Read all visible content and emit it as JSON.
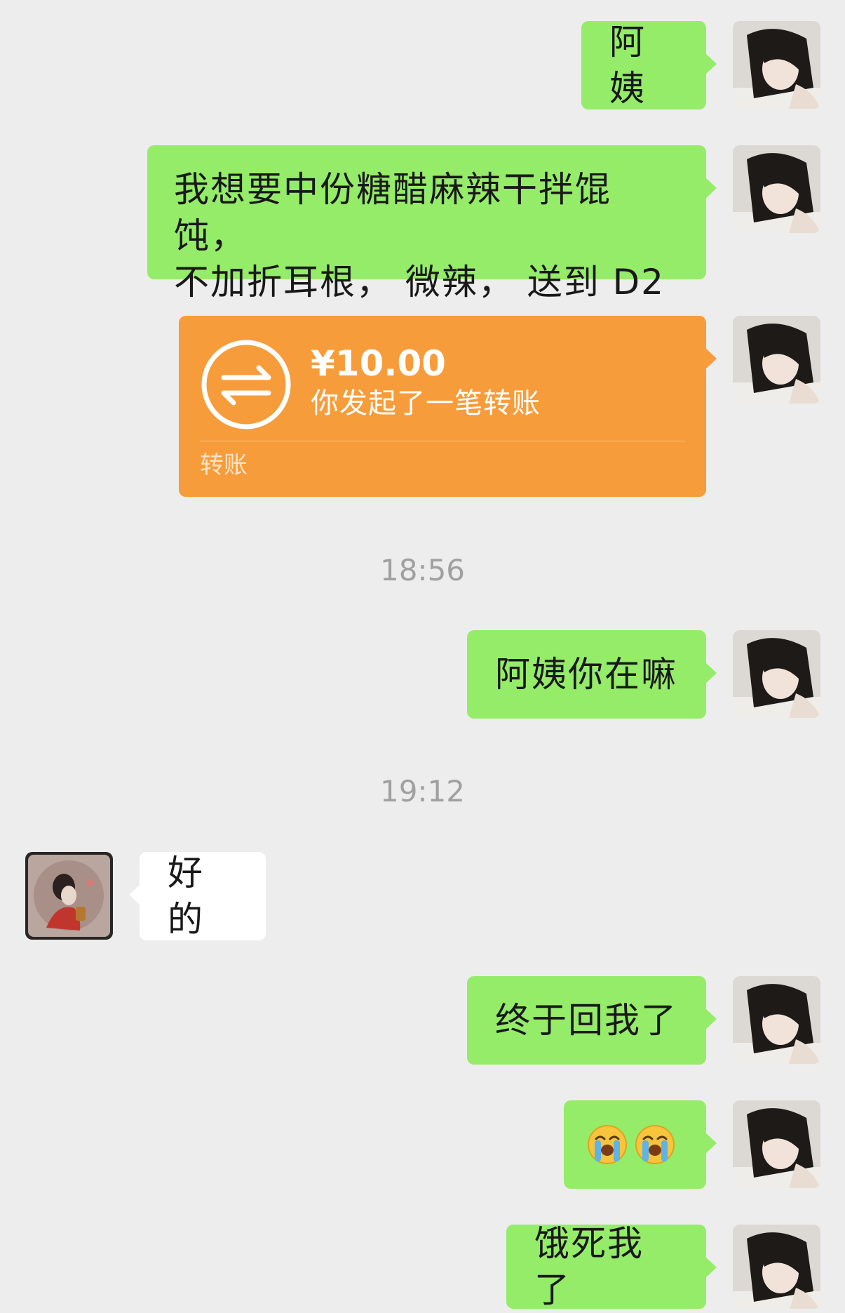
{
  "messages": {
    "m1": "阿姨",
    "m2_line1": "我想要中份糖醋麻辣干拌馄饨，",
    "m2_line2": "不加折耳根， 微辣， 送到 D2",
    "m4": "阿姨你在嘛",
    "m5": "好的",
    "m6": "终于回我了",
    "m8": "饿死我了"
  },
  "transfer": {
    "amount": "¥10.00",
    "description": "你发起了一笔转账",
    "label": "转账"
  },
  "timestamps": {
    "t1": "18:56",
    "t2": "19:12"
  },
  "emojis": [
    "loudly-crying-face",
    "loudly-crying-face"
  ],
  "colors": {
    "background": "#ededed",
    "outgoing_bubble": "#95ec69",
    "incoming_bubble": "#ffffff",
    "transfer_card": "#f79c3a",
    "timestamp_text": "#a0a0a0"
  }
}
